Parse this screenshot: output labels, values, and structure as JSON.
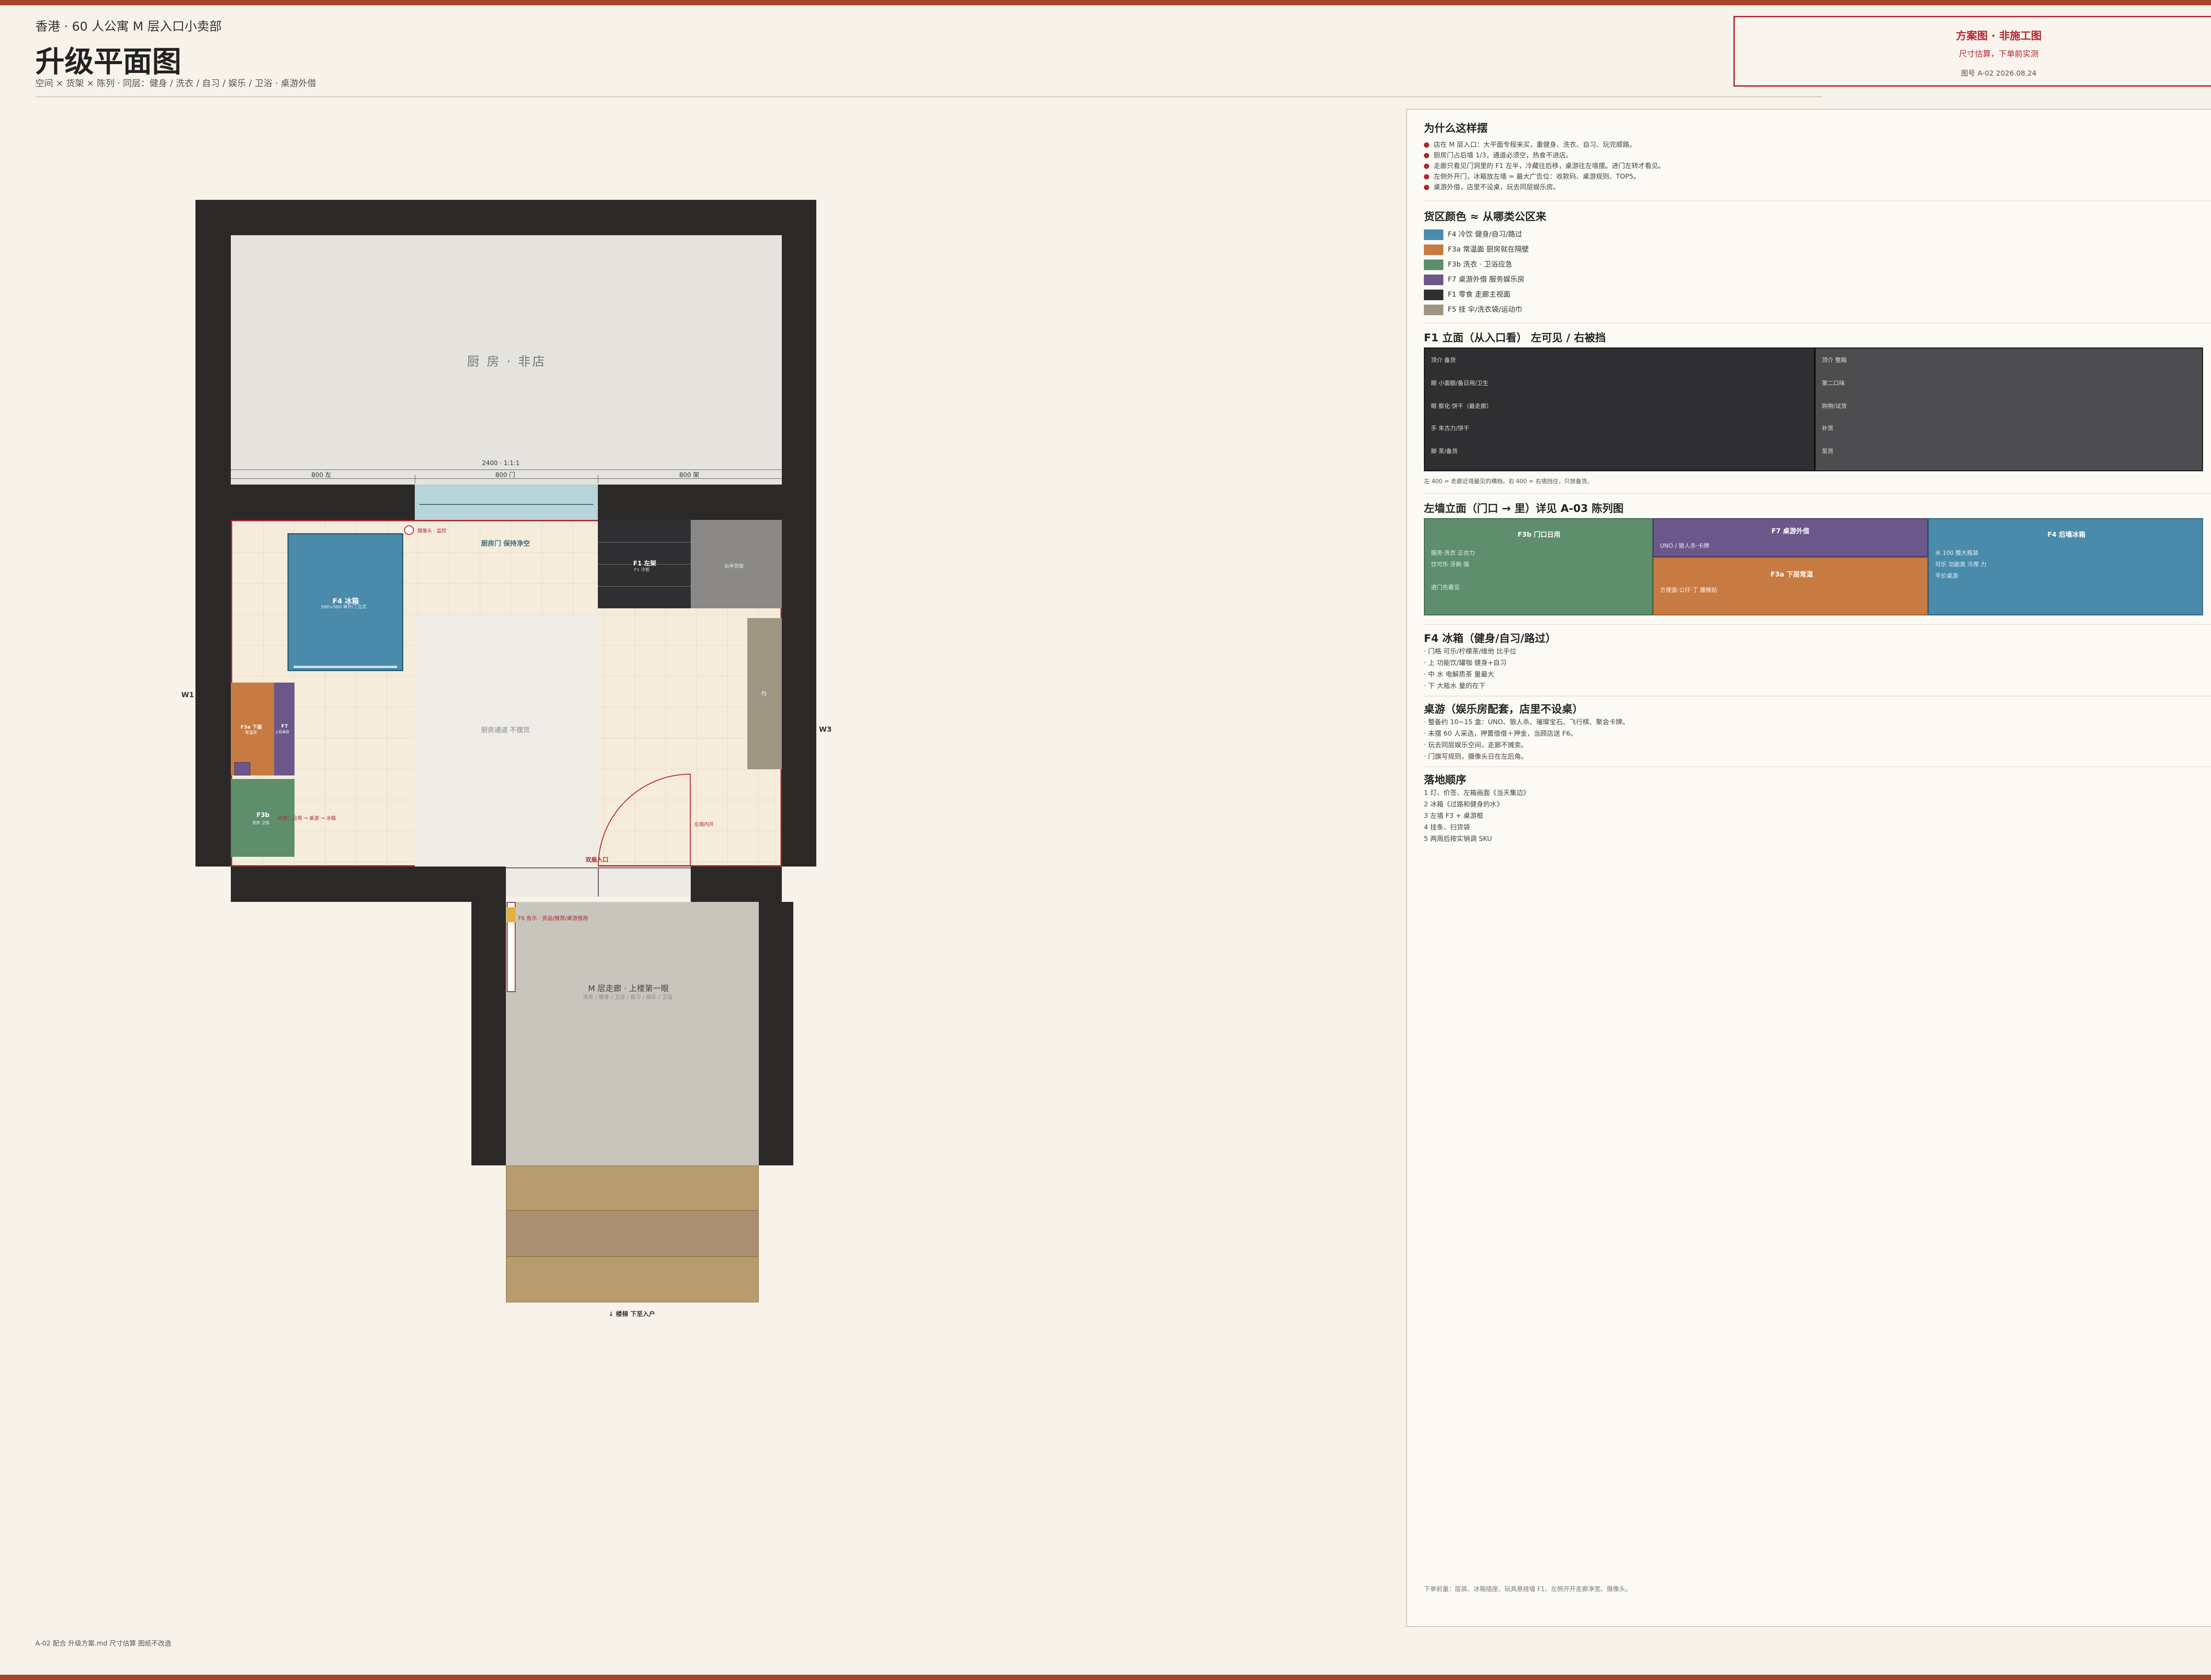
{
  "header": {
    "subtitle": "香港 · 60 人公寓 M 层入口小卖部",
    "title": "升级平面图",
    "description": "空间 × 货架 × 陈列 · 同层：健身 / 洗衣 / 自习 / 娱乐 / 卫浴 · 桌游外借"
  },
  "stamp": {
    "line1": "方案图 · 非施工图",
    "line2": "尺寸估算，下单前实测",
    "line3": "图号 A-02  2026.08.24"
  },
  "footer_note": "A-02 配合 升级方案.md  尺寸估算  图纸不改造",
  "colors": {
    "accent": "#b3262e",
    "wall": "#2a2928",
    "f4": "#4a8bab",
    "f3a": "#c77b42",
    "f3b": "#5e8e6c",
    "f7": "#6b578a",
    "f1": "#2f2f31",
    "f5": "#9e9582"
  },
  "plan": {
    "kitchen_label": "厨 房 · 非店",
    "dim_total": "2400 · 1:1:1",
    "dim_left": "800 左",
    "dim_mid": "800 门",
    "dim_right": "800 架",
    "kitchen_door": "厨房门 保持净空",
    "camera_label": "摄像头 · 监控",
    "f4_label": "F4 冰箱",
    "f4_sub": "580×580 单开门 立式",
    "f1_label": "F1 左架",
    "f1_sub": "F1 冷柜",
    "right_shelf": "右半货架",
    "center_label": "厨房通道 不摆货",
    "wall_left": "W1",
    "wall_right": "W3",
    "f3a_label": "F3a 下层",
    "f3a_sub": "常温货",
    "f7_label": "F7",
    "f7_sub": "上层桌游",
    "f3b_label": "F3b",
    "f3b_sub": "洗衣 卫浴",
    "route_label": "动线：日用 → 桌游 → 冰箱",
    "f5_label": "f5",
    "door_swing": "左扇内开",
    "entrance": "双扇入口",
    "corridor_label": "M 层走廊 · 上楼第一眼",
    "corridor_sub": "洗衣 / 健身 / 卫浴 / 自习 / 娱乐 / 卫浴",
    "f6_label": "F6 告示 · 货品/推荐/桌游借用",
    "stairs_label": "↓ 楼梯 下至入户"
  },
  "panel": {
    "why_title": "为什么这样摆",
    "why_items": [
      "店在 M 层入口：大平面专程来买，重健身、洗衣、自习、玩完顺路。",
      "厨房门占后墙 1/3，通道必须空，热食不进店。",
      "走廊只看见门洞里的 F1 左半，冷藏往后移，桌游往左墙摆。进门左转才看见。",
      "左侧外开门，冰箱放左墙 ≈ 最大广告位：收款码、桌游规则、TOP5。",
      "桌游外借，店里不设桌，玩去同层娱乐房。"
    ],
    "legend_title": "货区颜色 ≈ 从哪类公区来",
    "legend": [
      "F4 冷饮  健身/自习/路过",
      "F3a 常温面  厨房就在隔壁",
      "F3b 洗衣 · 卫浴应急",
      "F7 桌游外借  服务娱乐房",
      "F1 零食  走廊主视面",
      "F5 挂  伞/洗衣袋/运动巾"
    ],
    "elev_title": "F1 立面（从入口看） 左可见 / 右被挡",
    "elev_left": [
      "顶介 备货",
      "眼 小面额/备日用/卫生",
      "眼 膨化·饼干（最走廊）",
      "手 朱古力/饼干",
      "脚 泵/备货"
    ],
    "elev_right": [
      "顶介 整箱",
      "第二口味",
      "购物/试货",
      "补货",
      "泵货"
    ],
    "elev_note": "左 400 = 走廊近境最见的横档。右 400 = 右墙挡住，只放备货。",
    "wall_title": "左墙立面（门口 → 里）详见 A-03 陈列图",
    "wall_f3b": {
      "title": "F3b 门口日用",
      "l1": "服务·洗衣 正合力",
      "l2": "饮可乐·牙刷 强",
      "l3": "进门先看见"
    },
    "wall_f7": {
      "title": "F7 桌游外借",
      "l1": "UNO / 狼人杀·卡牌"
    },
    "wall_f3a": {
      "title": "F3a 下层常温",
      "l1": "方便面·公仔·丁 腰椎贴"
    },
    "wall_f4": {
      "title": "F4 后墙冰箱",
      "l1": "水 100 整大瓶装",
      "l2": "可乐 功能类 冷厚 力",
      "l3": "平价桌游"
    },
    "fridge_title": "F4 冰箱（健身/自习/路过）",
    "fridge_items": [
      "· 门格 可乐/柠檬茶/维他 比手位",
      "· 上 功能饮/罐咖 健身+自习",
      "· 中 水 电解质茶 量最大",
      "· 下 大瓶水 量的在下"
    ],
    "games_title": "桌游（娱乐房配套，店里不设桌）",
    "games_items": [
      "· 整备约 10~15 盒：UNO、狼人杀、璀璨宝石、飞行棋、聚会卡牌。",
      "· 未摆 60 人采选，押置借借＋押金，当顾店送 F6。",
      "· 玩去同层娱乐空间，走廊不摊卖。",
      "· 门旗写规则，摄像头日在左后角。"
    ],
    "order_title": "落地顺序",
    "order_items": [
      "1 灯、价签、左箱画面《当天集边》",
      "2 冰箱《过路和健身的水》",
      "3 左墙 F3 + 桌游框",
      "4 挂条、扫货袋",
      "5 两周后按实销调 SKU"
    ],
    "bottom_note": "下单前量：层高、冰箱插座、玩具悬挂墙 F1、左侧开开走廊净宽、摄像头。"
  }
}
